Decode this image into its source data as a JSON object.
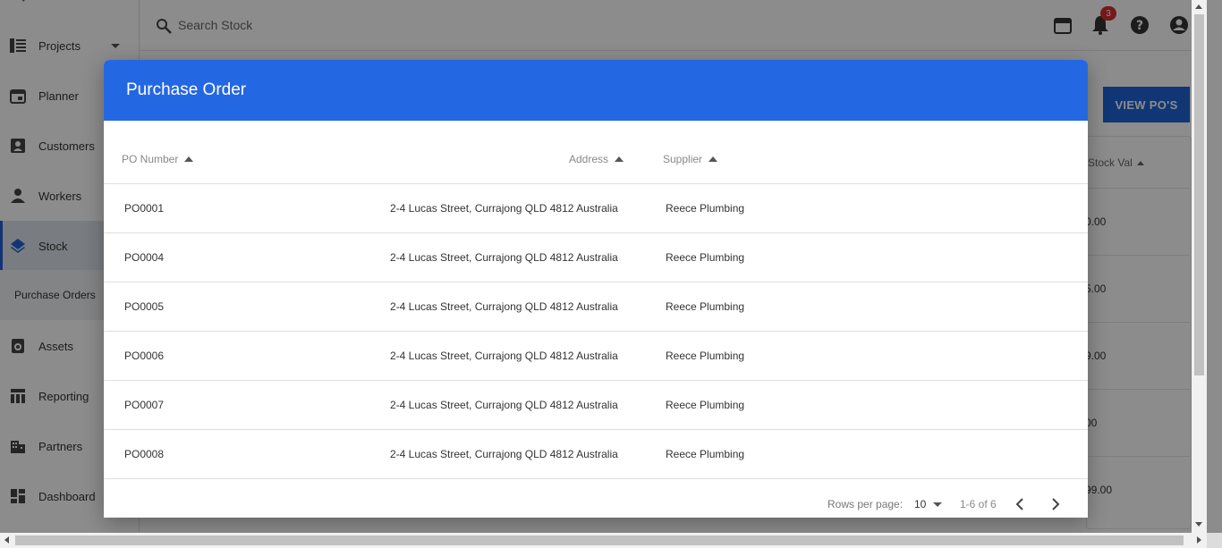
{
  "sidebar": {
    "items": [
      {
        "label": "Projects",
        "icon": "projects-icon"
      },
      {
        "label": "Planner",
        "icon": "calendar-icon"
      },
      {
        "label": "Customers",
        "icon": "contact-card-icon"
      },
      {
        "label": "Workers",
        "icon": "person-icon"
      },
      {
        "label": "Stock",
        "icon": "layers-icon"
      },
      {
        "label": "Assets",
        "icon": "asset-icon"
      },
      {
        "label": "Reporting",
        "icon": "table-icon"
      },
      {
        "label": "Partners",
        "icon": "building-icon"
      },
      {
        "label": "Dashboard",
        "icon": "dashboard-icon"
      }
    ],
    "sub_item": "Purchase Orders"
  },
  "topbar": {
    "search_placeholder": "Search Stock",
    "notification_count": "3"
  },
  "page": {
    "view_button": "VIEW PO'S",
    "bg_column_header": "Stock Val",
    "bg_values": [
      "0.00",
      "5.00",
      "9.00",
      "00",
      "99.00"
    ]
  },
  "modal": {
    "title": "Purchase Order",
    "columns": [
      "PO Number",
      "Address",
      "Supplier"
    ],
    "rows": [
      {
        "po": "PO0001",
        "address": "2-4 Lucas Street, Currajong QLD 4812 Australia",
        "supplier": "Reece Plumbing"
      },
      {
        "po": "PO0004",
        "address": "2-4 Lucas Street, Currajong QLD 4812 Australia",
        "supplier": "Reece Plumbing"
      },
      {
        "po": "PO0005",
        "address": "2-4 Lucas Street, Currajong QLD 4812 Australia",
        "supplier": "Reece Plumbing"
      },
      {
        "po": "PO0006",
        "address": "2-4 Lucas Street, Currajong QLD 4812 Australia",
        "supplier": "Reece Plumbing"
      },
      {
        "po": "PO0007",
        "address": "2-4 Lucas Street, Currajong QLD 4812 Australia",
        "supplier": "Reece Plumbing"
      },
      {
        "po": "PO0008",
        "address": "2-4 Lucas Street, Currajong QLD 4812 Australia",
        "supplier": "Reece Plumbing"
      }
    ],
    "footer": {
      "rows_per_page_label": "Rows per page:",
      "rows_per_page_value": "10",
      "range": "1-6 of 6"
    }
  },
  "colors": {
    "primary": "#2467e3",
    "button": "#1e63d6",
    "badge": "#d32f2f"
  }
}
